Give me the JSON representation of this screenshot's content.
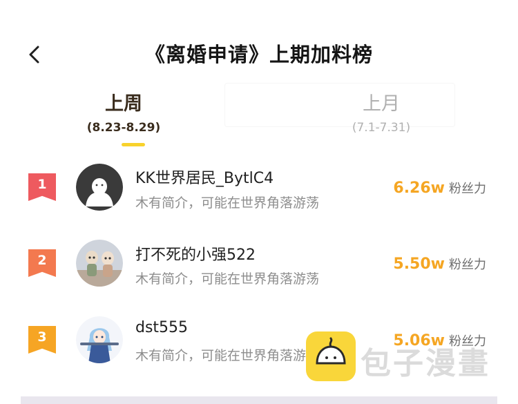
{
  "header": {
    "title": "《离婚申请》上期加料榜"
  },
  "tabs": [
    {
      "label": "上周",
      "range": "(8.23-8.29)",
      "active": true
    },
    {
      "label": "上月",
      "range": "(7.1-7.31)",
      "active": false
    }
  ],
  "ranking": [
    {
      "rank": "1",
      "badge_color": "#ee5a5f",
      "name": "KK世界居民_BytlC4",
      "bio": "木有简介，可能在世界角落游荡",
      "fans_value": "6.26w",
      "fans_unit": "粉丝力",
      "avatar": "default-avatar"
    },
    {
      "rank": "2",
      "badge_color": "#f3794f",
      "name": "打不死的小强522",
      "bio": "木有简介，可能在世界角落游荡",
      "fans_value": "5.50w",
      "fans_unit": "粉丝力",
      "avatar": "figurine-photo-avatar"
    },
    {
      "rank": "3",
      "badge_color": "#f6a524",
      "name": "dst555",
      "bio": "木有简介，可能在世界角落游荡",
      "fans_value": "5.06w",
      "fans_unit": "粉丝力",
      "avatar": "anime-character-avatar"
    }
  ],
  "watermark": {
    "text": "包子漫畫"
  },
  "colors": {
    "accent": "#f8d22c",
    "fans_value": "#f5a623"
  }
}
